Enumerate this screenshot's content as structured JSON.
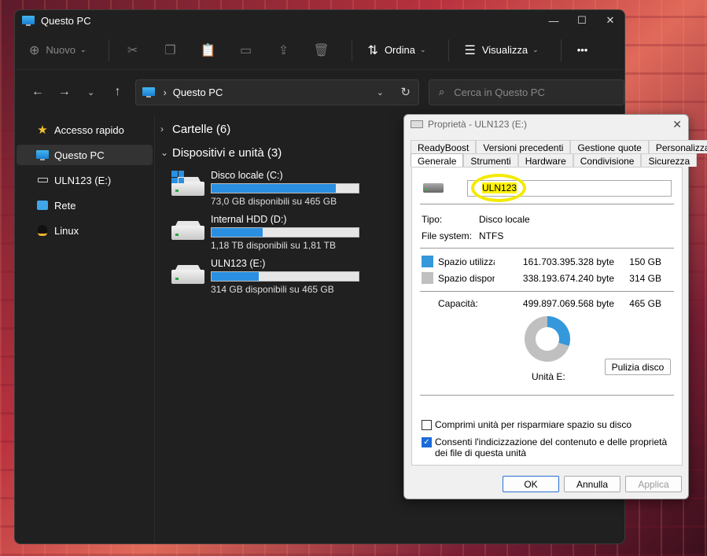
{
  "window": {
    "title": "Questo PC",
    "controls": [
      "—",
      "☐",
      "✕"
    ]
  },
  "toolbar": {
    "new_label": "Nuovo",
    "sort_label": "Ordina",
    "view_label": "Visualizza",
    "more_label": "•••"
  },
  "address": {
    "path": "Questo PC",
    "search_placeholder": "Cerca in Questo PC"
  },
  "sidebar": {
    "items": [
      {
        "label": "Accesso rapido"
      },
      {
        "label": "Questo PC"
      },
      {
        "label": "ULN123 (E:)"
      },
      {
        "label": "Rete"
      },
      {
        "label": "Linux"
      }
    ]
  },
  "content": {
    "folders_group": "Cartelle (6)",
    "devices_group": "Dispositivi e unità (3)",
    "drives": [
      {
        "name": "Disco locale (C:)",
        "free": "73,0 GB disponibili su 465 GB",
        "used_fraction": 0.843
      },
      {
        "name": "Internal HDD (D:)",
        "free": "1,18 TB disponibili su 1,81 TB",
        "used_fraction": 0.35
      },
      {
        "name": "ULN123 (E:)",
        "free": "314 GB disponibili su 465 GB",
        "used_fraction": 0.322
      }
    ]
  },
  "dialog": {
    "title": "Proprietà - ULN123 (E:)",
    "tabs_row1": [
      "ReadyBoost",
      "Versioni precedenti",
      "Gestione quote",
      "Personalizza"
    ],
    "tabs_row2": [
      "Generale",
      "Strumenti",
      "Hardware",
      "Condivisione",
      "Sicurezza"
    ],
    "name_value": "ULN123",
    "type_label": "Tipo:",
    "type_value": "Disco locale",
    "fs_label": "File system:",
    "fs_value": "NTFS",
    "used_label": "Spazio utilizzato:",
    "used_bytes": "161.703.395.328 byte",
    "used_gb": "150 GB",
    "free_label": "Spazio disponibile:",
    "free_bytes": "338.193.674.240 byte",
    "free_gb": "314 GB",
    "capacity_label": "Capacità:",
    "capacity_bytes": "499.897.069.568 byte",
    "capacity_gb": "465 GB",
    "drive_label": "Unità E:",
    "cleanup_button": "Pulizia disco",
    "compress_label": "Comprimi unità per risparmiare spazio su disco",
    "index_label": "Consenti l'indicizzazione del contenuto e delle proprietà dei file di questa unità",
    "ok_button": "OK",
    "cancel_button": "Annulla",
    "apply_button": "Applica",
    "used_color": "#3498db",
    "free_color": "#c0c0c0"
  }
}
